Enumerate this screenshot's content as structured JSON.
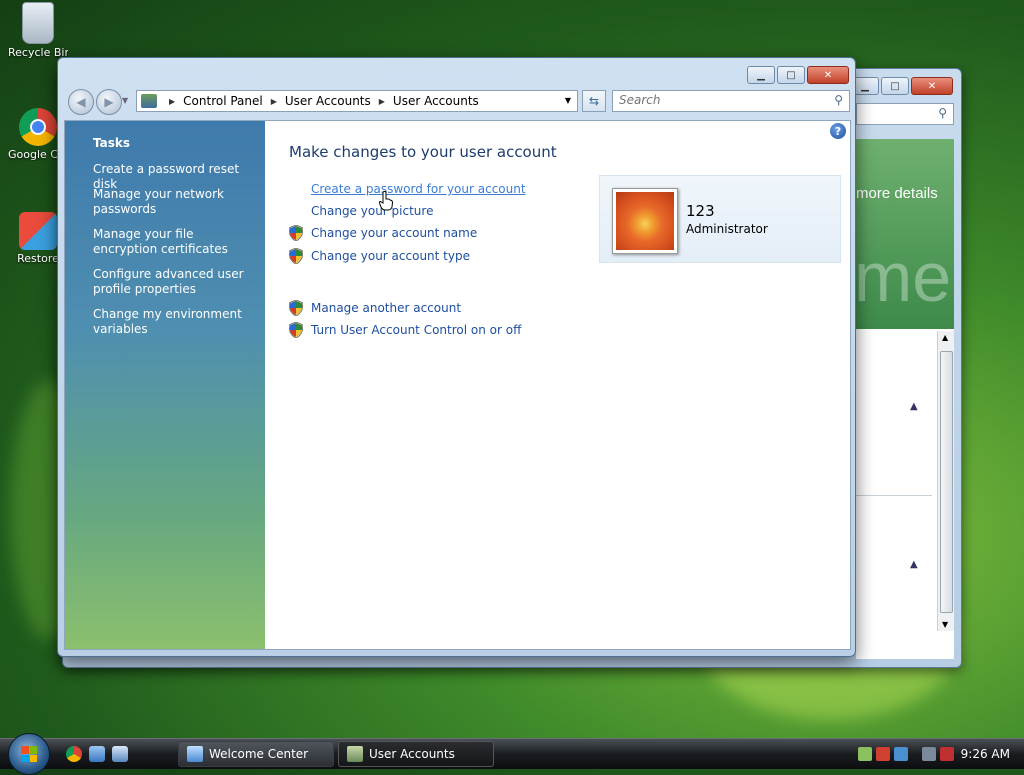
{
  "desktop": {
    "icons": [
      {
        "label": "Recycle Bin"
      },
      {
        "label": "Google Chrome"
      },
      {
        "label": "Restore"
      }
    ]
  },
  "back_window": {
    "title": "Welcome Center",
    "more_details": "more details",
    "big_text": "me"
  },
  "window": {
    "title": "User Accounts",
    "address": [
      "Control Panel",
      "User Accounts",
      "User Accounts"
    ],
    "search_placeholder": "Search",
    "tasks": {
      "header": "Tasks",
      "links": [
        "Create a password reset disk",
        "Manage your network passwords",
        "Manage your file encryption certificates",
        "Configure advanced user profile properties",
        "Change my environment variables"
      ]
    },
    "main": {
      "heading": "Make changes to your user account",
      "links": [
        {
          "label": "Create a password for your account",
          "shield": false
        },
        {
          "label": "Change your picture",
          "shield": false
        },
        {
          "label": "Change your account name",
          "shield": true
        },
        {
          "label": "Change your account type",
          "shield": true
        },
        {
          "label": "Manage another account",
          "shield": true
        },
        {
          "label": "Turn User Account Control on or off",
          "shield": true
        }
      ],
      "user": {
        "name": "123",
        "role": "Administrator"
      }
    }
  },
  "taskbar": {
    "buttons": [
      "Welcome Center",
      "User Accounts"
    ],
    "active": "User Accounts",
    "clock": "9:26 AM"
  },
  "colors": {
    "link": "#1e4e9e",
    "link_hover": "#3a7cd6",
    "heading": "#1e3c6e"
  }
}
